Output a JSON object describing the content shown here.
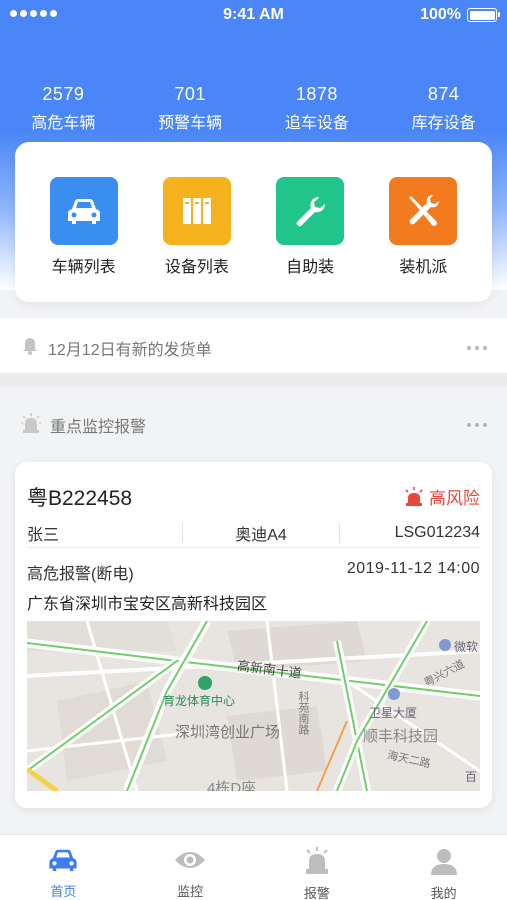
{
  "status_bar": {
    "time": "9:41 AM",
    "battery": "100%"
  },
  "stats": [
    {
      "value": "2579",
      "label": "高危车辆"
    },
    {
      "value": "701",
      "label": "预警车辆"
    },
    {
      "value": "1878",
      "label": "追车设备"
    },
    {
      "value": "874",
      "label": "库存设备"
    }
  ],
  "quick_actions": [
    {
      "label": "车辆列表",
      "icon": "car-icon",
      "color": "#3a8ef0"
    },
    {
      "label": "设备列表",
      "icon": "device-icon",
      "color": "#f6b11f"
    },
    {
      "label": "自助装",
      "icon": "wrench-icon",
      "color": "#21c48a"
    },
    {
      "label": "装机派",
      "icon": "tools-icon",
      "color": "#f27a1f"
    }
  ],
  "notice": {
    "text": "12月12日有新的发货单"
  },
  "monitor_section": {
    "title": "重点监控报警"
  },
  "alarm": {
    "plate": "粤B222458",
    "risk": "高风险",
    "owner": "张三",
    "model": "奥迪A4",
    "vin": "LSG012234",
    "type": "高危报警(断电)",
    "time": "2019-11-12   14:00",
    "address": "广东省深圳市宝安区高新科技园区"
  },
  "map_labels": {
    "road_main": "高新南十道",
    "gym": "育龙体育中心",
    "plaza": "深圳湾创业广场",
    "tower": "卫星大厦",
    "park": "顺丰科技园",
    "road_east": "海天二路",
    "road_ne": "粤兴六道",
    "poi_ms": "微软",
    "poi_bai": "百",
    "building": "4栋D座",
    "road_v": "科苑南路"
  },
  "tabs": [
    {
      "label": "首页",
      "icon": "home-car-icon"
    },
    {
      "label": "监控",
      "icon": "eye-icon"
    },
    {
      "label": "报警",
      "icon": "alarm-icon"
    },
    {
      "label": "我的",
      "icon": "user-icon"
    }
  ],
  "colors": {
    "primary": "#4a86f7",
    "risk": "#e8473a",
    "tab_active": "#3d7cf2"
  }
}
